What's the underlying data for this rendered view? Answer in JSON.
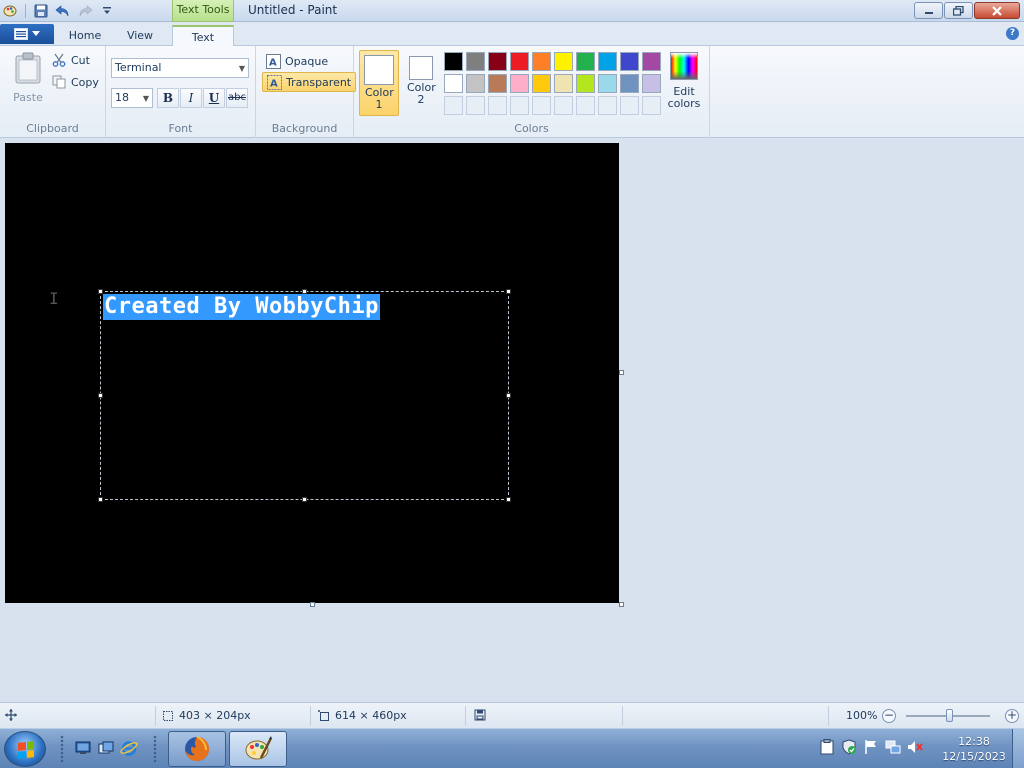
{
  "window": {
    "title": "Untitled - Paint",
    "context_tab": "Text Tools"
  },
  "tabs": [
    {
      "label": "Home",
      "active": false
    },
    {
      "label": "View",
      "active": false
    },
    {
      "label": "Text",
      "active": true
    }
  ],
  "clipboard": {
    "paste_label": "Paste",
    "cut_label": "Cut",
    "copy_label": "Copy",
    "group_label": "Clipboard"
  },
  "font": {
    "family": "Terminal",
    "size": "18",
    "bold_label": "B",
    "italic_label": "I",
    "underline_label": "U",
    "strike_label": "abc",
    "group_label": "Font"
  },
  "background": {
    "opaque_label": "Opaque",
    "transparent_label": "Transparent",
    "selected": "Transparent",
    "group_label": "Background"
  },
  "colors": {
    "color1_label": "Color 1",
    "color1_value": "#ffffff",
    "color2_label": "Color 2",
    "color2_value": "#ffffff",
    "edit_label": "Edit colors",
    "group_label": "Colors",
    "palette": [
      "#000000",
      "#7f7f7f",
      "#880015",
      "#ed1c24",
      "#ff7f27",
      "#fff200",
      "#22b14c",
      "#00a2e8",
      "#3f48cc",
      "#a349a4",
      "#ffffff",
      "#c3c3c3",
      "#b97a57",
      "#ffaec9",
      "#ffc90e",
      "#efe4b0",
      "#b5e61d",
      "#99d9ea",
      "#7092be",
      "#c8bfe7"
    ]
  },
  "canvas": {
    "background": "#000000",
    "text": "Created By WobbyChip",
    "selection_color": "#3399ff"
  },
  "status": {
    "selection_size": "403 × 204px",
    "canvas_size": "614 × 460px",
    "zoom": "100%"
  },
  "taskbar": {
    "time": "12:38",
    "date": "12/15/2023"
  }
}
